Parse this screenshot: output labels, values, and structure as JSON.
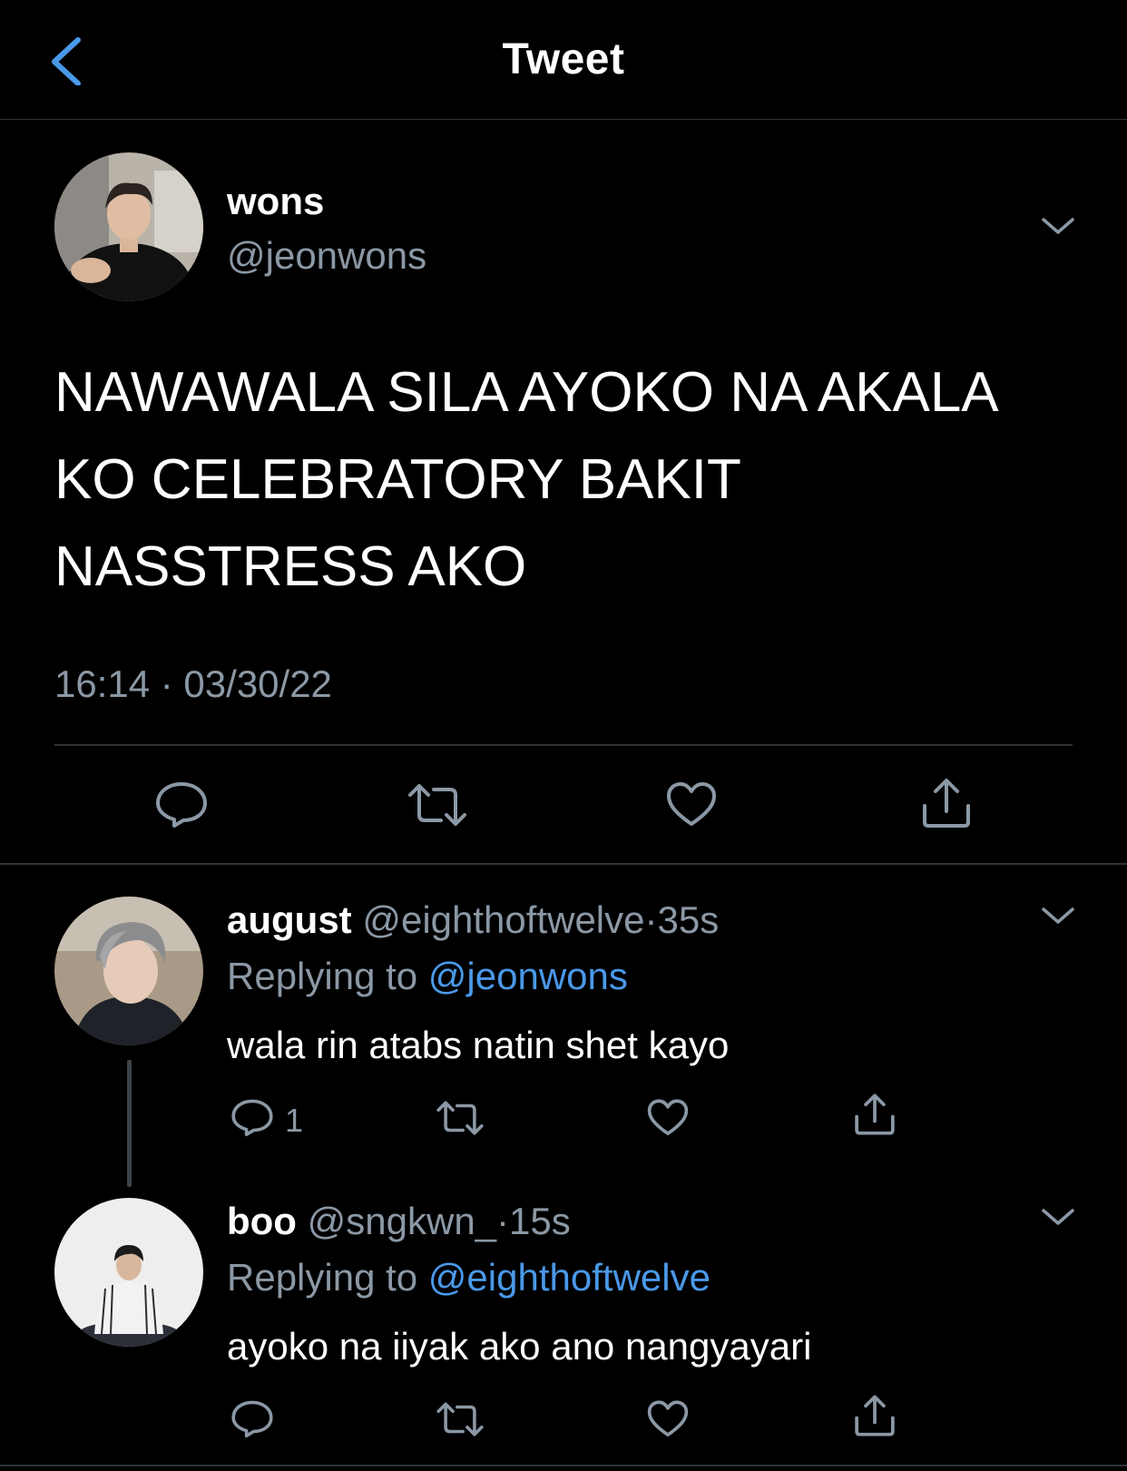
{
  "header": {
    "title": "Tweet"
  },
  "tweet": {
    "name": "wons",
    "handle": "@jeonwons",
    "text": "NAWAWALA SILA AYOKO NA AKALA\nKO CELEBRATORY BAKIT\nNASSTRESS AKO",
    "timestamp": "16:14 · 03/30/22"
  },
  "replies": [
    {
      "name": "august",
      "handle": "@eighthoftwelve",
      "sep": "·",
      "time": "35s",
      "replying_prefix": "Replying to",
      "replying_to": "@jeonwons",
      "text": "wala rin atabs natin shet kayo",
      "reply_count": "1"
    },
    {
      "name": "boo",
      "handle": "@sngkwn_",
      "sep": "·",
      "time": "15s",
      "replying_prefix": "Replying to",
      "replying_to": "@eighthoftwelve",
      "text": "ayoko na iiyak ako ano nangyayari",
      "reply_count": ""
    }
  ],
  "icons": {
    "back": "chevron-left-icon",
    "more": "chevron-down-icon",
    "reply": "comment-icon",
    "retweet": "retweet-icon",
    "like": "heart-icon",
    "share": "share-icon"
  },
  "colors": {
    "background": "#000000",
    "accent": "#4a99e9",
    "secondary_text": "#8b98a5",
    "divider": "#2f3336"
  }
}
